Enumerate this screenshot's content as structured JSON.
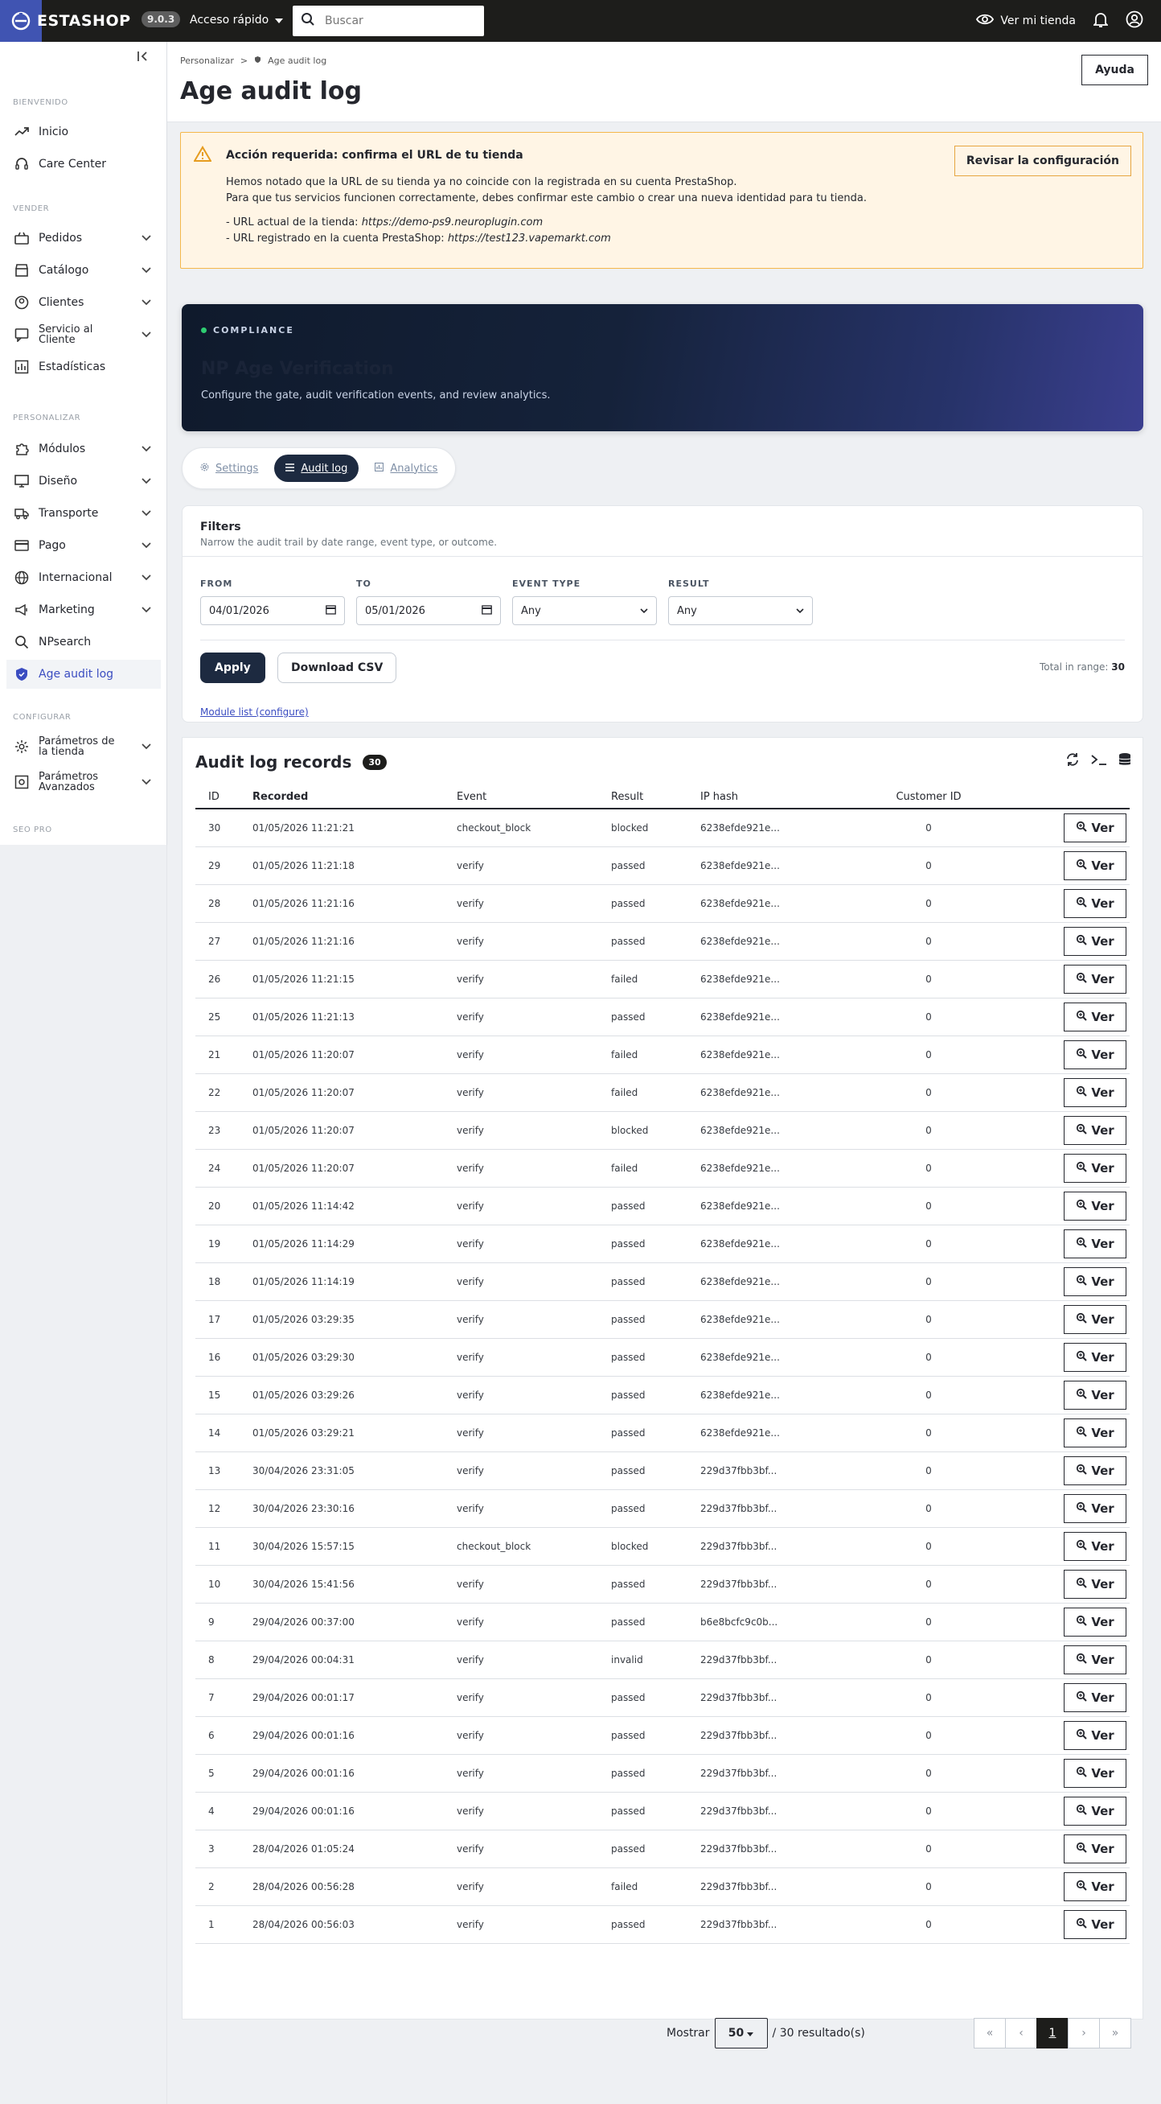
{
  "topbar": {
    "logo_text": "ESTASHOP",
    "version": "9.0.3",
    "quick_access": "Acceso rápido",
    "search_placeholder": "Buscar",
    "view_store": "Ver mi tienda"
  },
  "sidebar": {
    "sections": [
      "Bienvenido",
      "Vender",
      "Personalizar",
      "Configurar",
      "SEO PRO"
    ],
    "items": [
      {
        "label": "Inicio",
        "icon": "trending-icon"
      },
      {
        "label": "Care Center",
        "icon": "headset-icon"
      },
      {
        "label": "Pedidos",
        "icon": "cart-icon"
      },
      {
        "label": "Catálogo",
        "icon": "store-icon"
      },
      {
        "label": "Clientes",
        "icon": "user-circle-icon"
      },
      {
        "label": "Servicio al Cliente",
        "icon": "chat-icon"
      },
      {
        "label": "Estadísticas",
        "icon": "bar-chart-icon"
      },
      {
        "label": "Módulos",
        "icon": "puzzle-icon"
      },
      {
        "label": "Diseño",
        "icon": "monitor-icon"
      },
      {
        "label": "Transporte",
        "icon": "truck-icon"
      },
      {
        "label": "Pago",
        "icon": "credit-card-icon"
      },
      {
        "label": "Internacional",
        "icon": "globe-icon"
      },
      {
        "label": "Marketing",
        "icon": "megaphone-icon"
      },
      {
        "label": "NPsearch",
        "icon": "search-icon"
      },
      {
        "label": "Age audit log",
        "icon": "shield-icon"
      },
      {
        "label": "Parámetros de la tienda",
        "icon": "gear-icon"
      },
      {
        "label": "Parámetros Avanzados",
        "icon": "settings-box-icon"
      }
    ]
  },
  "header": {
    "breadcrumb_parent": "Personalizar",
    "breadcrumb_current": "Age audit log",
    "title": "Age audit log",
    "help": "Ayuda"
  },
  "alert": {
    "title": "Acción requerida: confirma el URL de tu tienda",
    "line1": "Hemos notado que la URL de su tienda ya no coincide con la registrada en su cuenta PrestaShop.",
    "line2": "Para que tus servicios funcionen correctamente, debes confirmar este cambio o crear una nueva identidad para tu tienda.",
    "line3_prefix": "- URL actual de la tienda: ",
    "line3_url": "https://demo-ps9.neuroplugin.com",
    "line4_prefix": "- URL registrado en la cuenta PrestaShop: ",
    "line4_url": "https://test123.vapemarkt.com",
    "button": "Revisar la configuración"
  },
  "hero": {
    "kicker": "COMPLIANCE",
    "title": "NP Age Verification",
    "subtitle": "Configure the gate, audit verification events, and review analytics."
  },
  "tabs": [
    {
      "label": "Settings",
      "active": false
    },
    {
      "label": "Audit log",
      "active": true
    },
    {
      "label": "Analytics",
      "active": false
    }
  ],
  "filters": {
    "title": "Filters",
    "subtitle": "Narrow the audit trail by date range, event type, or outcome.",
    "from_label": "FROM",
    "from_value": "04/01/2026",
    "to_label": "TO",
    "to_value": "05/01/2026",
    "event_label": "EVENT TYPE",
    "event_value": "Any",
    "result_label": "RESULT",
    "result_value": "Any",
    "apply": "Apply",
    "download": "Download CSV",
    "total_label": "Total in range:",
    "total_value": "30",
    "module_link": "Module list (configure)"
  },
  "records": {
    "title": "Audit log records",
    "count": "30",
    "columns": [
      "ID",
      "Recorded",
      "Event",
      "Result",
      "IP hash",
      "Customer ID"
    ],
    "action_label": "Ver",
    "rows": [
      [
        "30",
        "01/05/2026 11:21:21",
        "checkout_block",
        "blocked",
        "6238efde921e...",
        "0"
      ],
      [
        "29",
        "01/05/2026 11:21:18",
        "verify",
        "passed",
        "6238efde921e...",
        "0"
      ],
      [
        "28",
        "01/05/2026 11:21:16",
        "verify",
        "passed",
        "6238efde921e...",
        "0"
      ],
      [
        "27",
        "01/05/2026 11:21:16",
        "verify",
        "passed",
        "6238efde921e...",
        "0"
      ],
      [
        "26",
        "01/05/2026 11:21:15",
        "verify",
        "failed",
        "6238efde921e...",
        "0"
      ],
      [
        "25",
        "01/05/2026 11:21:13",
        "verify",
        "passed",
        "6238efde921e...",
        "0"
      ],
      [
        "21",
        "01/05/2026 11:20:07",
        "verify",
        "failed",
        "6238efde921e...",
        "0"
      ],
      [
        "22",
        "01/05/2026 11:20:07",
        "verify",
        "failed",
        "6238efde921e...",
        "0"
      ],
      [
        "23",
        "01/05/2026 11:20:07",
        "verify",
        "blocked",
        "6238efde921e...",
        "0"
      ],
      [
        "24",
        "01/05/2026 11:20:07",
        "verify",
        "failed",
        "6238efde921e...",
        "0"
      ],
      [
        "20",
        "01/05/2026 11:14:42",
        "verify",
        "passed",
        "6238efde921e...",
        "0"
      ],
      [
        "19",
        "01/05/2026 11:14:29",
        "verify",
        "passed",
        "6238efde921e...",
        "0"
      ],
      [
        "18",
        "01/05/2026 11:14:19",
        "verify",
        "passed",
        "6238efde921e...",
        "0"
      ],
      [
        "17",
        "01/05/2026 03:29:35",
        "verify",
        "passed",
        "6238efde921e...",
        "0"
      ],
      [
        "16",
        "01/05/2026 03:29:30",
        "verify",
        "passed",
        "6238efde921e...",
        "0"
      ],
      [
        "15",
        "01/05/2026 03:29:26",
        "verify",
        "passed",
        "6238efde921e...",
        "0"
      ],
      [
        "14",
        "01/05/2026 03:29:21",
        "verify",
        "passed",
        "6238efde921e...",
        "0"
      ],
      [
        "13",
        "30/04/2026 23:31:05",
        "verify",
        "passed",
        "229d37fbb3bf...",
        "0"
      ],
      [
        "12",
        "30/04/2026 23:30:16",
        "verify",
        "passed",
        "229d37fbb3bf...",
        "0"
      ],
      [
        "11",
        "30/04/2026 15:57:15",
        "checkout_block",
        "blocked",
        "229d37fbb3bf...",
        "0"
      ],
      [
        "10",
        "30/04/2026 15:41:56",
        "verify",
        "passed",
        "229d37fbb3bf...",
        "0"
      ],
      [
        "9",
        "29/04/2026 00:37:00",
        "verify",
        "passed",
        "b6e8bcfc9c0b...",
        "0"
      ],
      [
        "8",
        "29/04/2026 00:04:31",
        "verify",
        "invalid",
        "229d37fbb3bf...",
        "0"
      ],
      [
        "7",
        "29/04/2026 00:01:17",
        "verify",
        "passed",
        "229d37fbb3bf...",
        "0"
      ],
      [
        "6",
        "29/04/2026 00:01:16",
        "verify",
        "passed",
        "229d37fbb3bf...",
        "0"
      ],
      [
        "5",
        "29/04/2026 00:01:16",
        "verify",
        "passed",
        "229d37fbb3bf...",
        "0"
      ],
      [
        "4",
        "29/04/2026 00:01:16",
        "verify",
        "passed",
        "229d37fbb3bf...",
        "0"
      ],
      [
        "3",
        "28/04/2026 01:05:24",
        "verify",
        "passed",
        "229d37fbb3bf...",
        "0"
      ],
      [
        "2",
        "28/04/2026 00:56:28",
        "verify",
        "failed",
        "229d37fbb3bf...",
        "0"
      ],
      [
        "1",
        "28/04/2026 00:56:03",
        "verify",
        "passed",
        "229d37fbb3bf...",
        "0"
      ]
    ]
  },
  "pagination": {
    "show_label": "Mostrar",
    "per_page": "50",
    "results": "/ 30 resultado(s)",
    "first": "«",
    "prev": "‹",
    "current": "1",
    "next": "›",
    "last": "»"
  },
  "colors": {
    "topbar": "#1d1d1b",
    "brand": "#4054b2",
    "active_link": "#3b4dc1",
    "alert_bg": "#fff5e5",
    "alert_border": "#f5b74a",
    "tab_active": "#1d2a40"
  }
}
